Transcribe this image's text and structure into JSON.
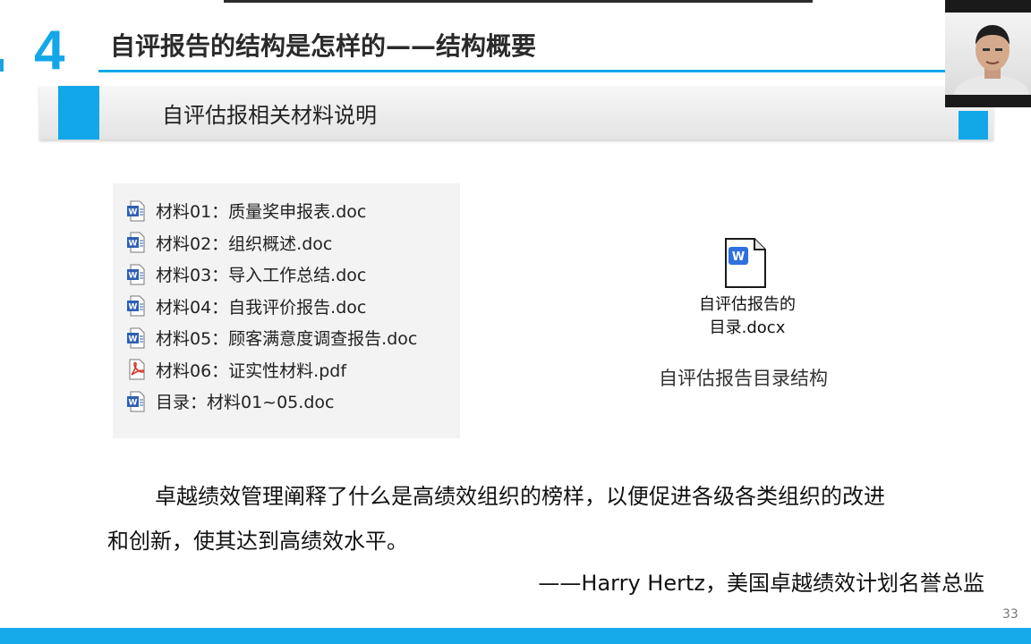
{
  "slide": {
    "section_number": "4",
    "title": "自评报告的结构是怎样的——结构概要",
    "subtitle": "自评估报相关材料说明",
    "page_number": "33"
  },
  "file_list": [
    {
      "icon": "word-doc-icon",
      "label": "材料01：质量奖申报表.doc"
    },
    {
      "icon": "word-doc-icon",
      "label": "材料02：组织概述.doc"
    },
    {
      "icon": "word-doc-icon",
      "label": "材料03：导入工作总结.doc"
    },
    {
      "icon": "word-doc-icon",
      "label": "材料04：自我评价报告.doc"
    },
    {
      "icon": "word-doc-icon",
      "label": "材料05：顾客满意度调查报告.doc"
    },
    {
      "icon": "pdf-icon",
      "label": "材料06：证实性材料.pdf"
    },
    {
      "icon": "word-doc-icon",
      "label": "目录：材料01~05.doc"
    }
  ],
  "attachment": {
    "icon": "word-docx-icon",
    "name_line1": "自评估报告的",
    "name_line2": "目录.docx",
    "caption": "自评估报告目录结构"
  },
  "quote": {
    "line1": "卓越绩效管理阐释了什么是高绩效组织的榜样，以便促进各级各类组织的改进",
    "line2": "和创新，使其达到高绩效水平。",
    "attribution": "——Harry Hertz，美国卓越绩效计划名誉总监"
  },
  "colors": {
    "accent": "#12a7e8",
    "bottom_bar": "#16a9ea",
    "title_text": "#2a2a2a",
    "word_icon": "#2f5fb3",
    "pdf_icon": "#d9342b"
  }
}
